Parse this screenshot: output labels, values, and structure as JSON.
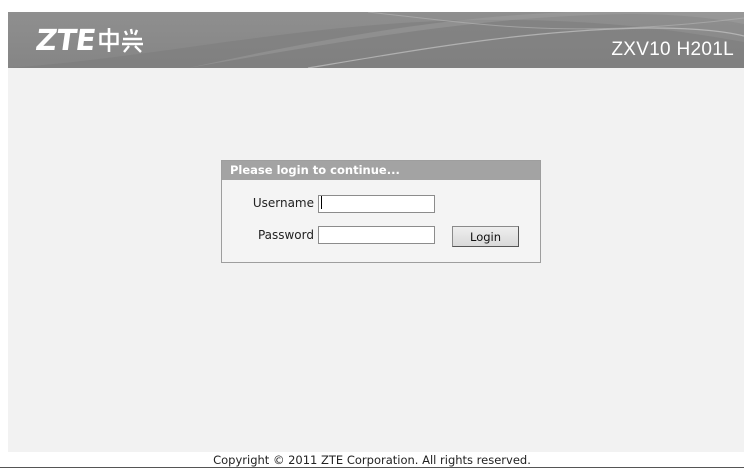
{
  "header": {
    "brand_latin": "ZTE",
    "brand_chinese": "中兴",
    "model": "ZXV10 H201L"
  },
  "login": {
    "title": "Please login to continue...",
    "username_label": "Username",
    "username_value": "",
    "password_label": "Password",
    "password_value": "",
    "button_label": "Login"
  },
  "footer": {
    "copyright": "Copyright © 2011 ZTE Corporation. All rights reserved."
  },
  "colors": {
    "header_bg": "#8a8a8a",
    "content_bg": "#f2f2f2",
    "login_title_bg": "#a3a3a3",
    "text": "#222222"
  }
}
